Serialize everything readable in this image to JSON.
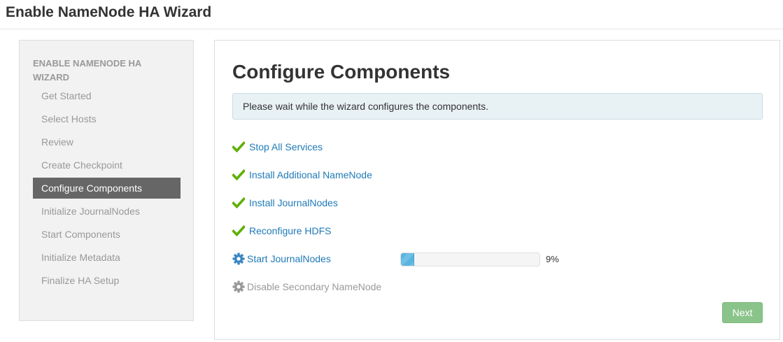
{
  "header": {
    "title": "Enable NameNode HA Wizard"
  },
  "sidebar": {
    "heading": "ENABLE NAMENODE HA WIZARD",
    "items": [
      {
        "label": "Get Started",
        "active": false
      },
      {
        "label": "Select Hosts",
        "active": false
      },
      {
        "label": "Review",
        "active": false
      },
      {
        "label": "Create Checkpoint",
        "active": false
      },
      {
        "label": "Configure Components",
        "active": true
      },
      {
        "label": "Initialize JournalNodes",
        "active": false
      },
      {
        "label": "Start Components",
        "active": false
      },
      {
        "label": "Initialize Metadata",
        "active": false
      },
      {
        "label": "Finalize HA Setup",
        "active": false
      }
    ]
  },
  "main": {
    "title": "Configure Components",
    "alert": "Please wait while the wizard configures the components.",
    "tasks": [
      {
        "label": "Stop All Services",
        "status": "completed",
        "icon": "check-icon"
      },
      {
        "label": "Install Additional NameNode",
        "status": "completed",
        "icon": "check-icon"
      },
      {
        "label": "Install JournalNodes",
        "status": "completed",
        "icon": "check-icon"
      },
      {
        "label": "Reconfigure HDFS",
        "status": "completed",
        "icon": "check-icon"
      },
      {
        "label": "Start JournalNodes",
        "status": "in-progress",
        "icon": "gear-icon",
        "progress_percent": 9,
        "progress_text": "9%"
      },
      {
        "label": "Disable Secondary NameNode",
        "status": "pending",
        "icon": "gear-icon"
      }
    ],
    "next_label": "Next"
  },
  "colors": {
    "check": "#5cb000",
    "link": "#1f7ab8",
    "gear_active": "#3a87c0",
    "gear_pending": "#999999",
    "active_nav_bg": "#666666",
    "next_button_bg": "#8bc48a"
  }
}
